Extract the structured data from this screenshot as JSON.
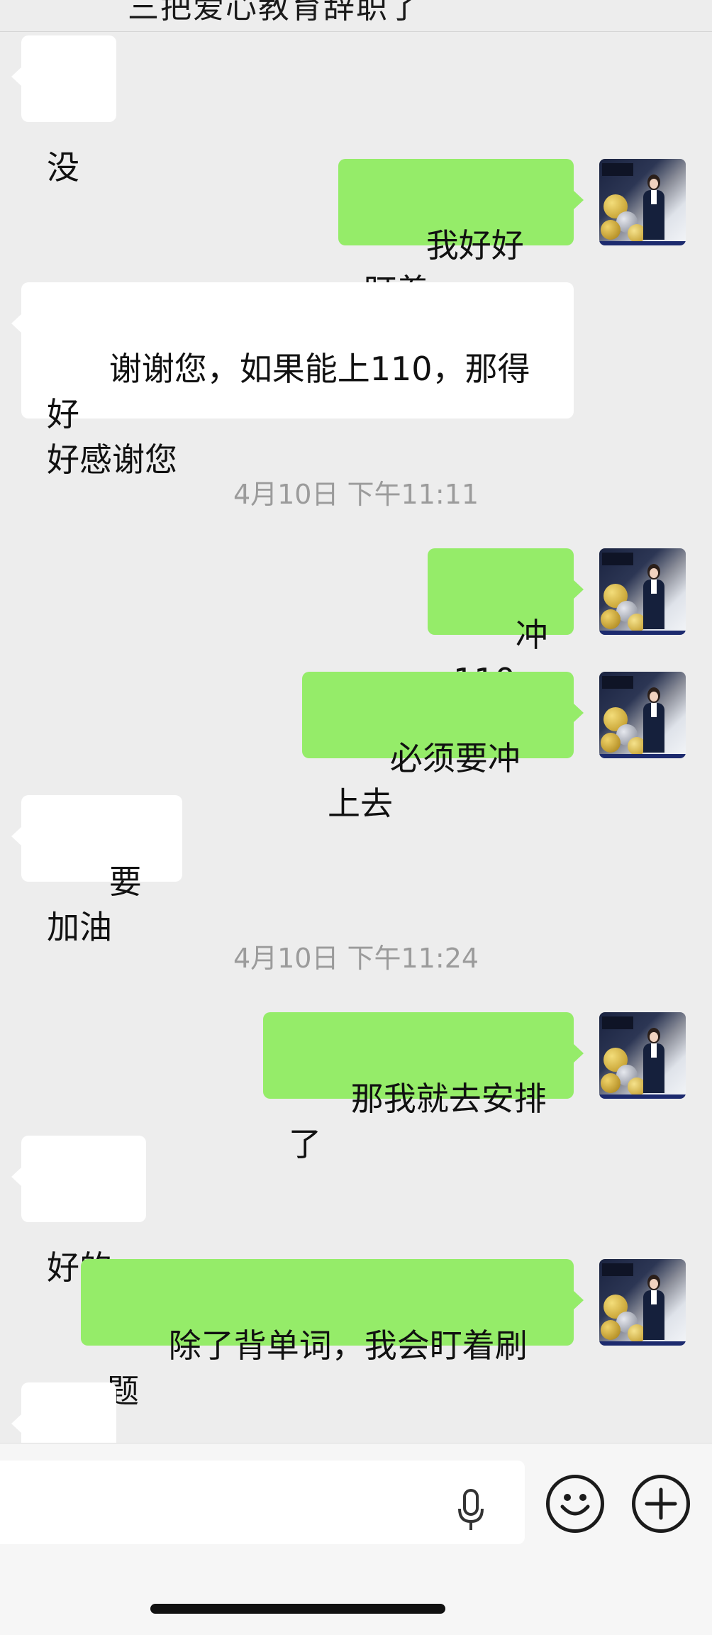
{
  "header": {
    "title": "三把爱心教育辞职了"
  },
  "messages": [
    {
      "side": "left",
      "kind": "text",
      "text": "没"
    },
    {
      "side": "right",
      "kind": "text",
      "text": "我好好盯着"
    },
    {
      "side": "left",
      "kind": "text",
      "text": "谢谢您，如果能上110，那得好\n好感谢您"
    },
    {
      "kind": "time",
      "text": "4月10日 下午11:11"
    },
    {
      "side": "right",
      "kind": "text",
      "text": "冲110"
    },
    {
      "side": "right",
      "kind": "text",
      "text": "必须要冲上去"
    },
    {
      "side": "left",
      "kind": "text",
      "text": "要加油"
    },
    {
      "kind": "time",
      "text": "4月10日 下午11:24"
    },
    {
      "side": "right",
      "kind": "text",
      "text": "那我就去安排了"
    },
    {
      "side": "left",
      "kind": "text",
      "text": "好的"
    },
    {
      "side": "right",
      "kind": "text",
      "text": "除了背单词，我会盯着刷题"
    },
    {
      "side": "left",
      "kind": "emoji",
      "text": "👌"
    }
  ],
  "input_bar": {
    "value": "",
    "icons": [
      "microphone-icon",
      "emoji-icon",
      "plus-icon"
    ]
  }
}
